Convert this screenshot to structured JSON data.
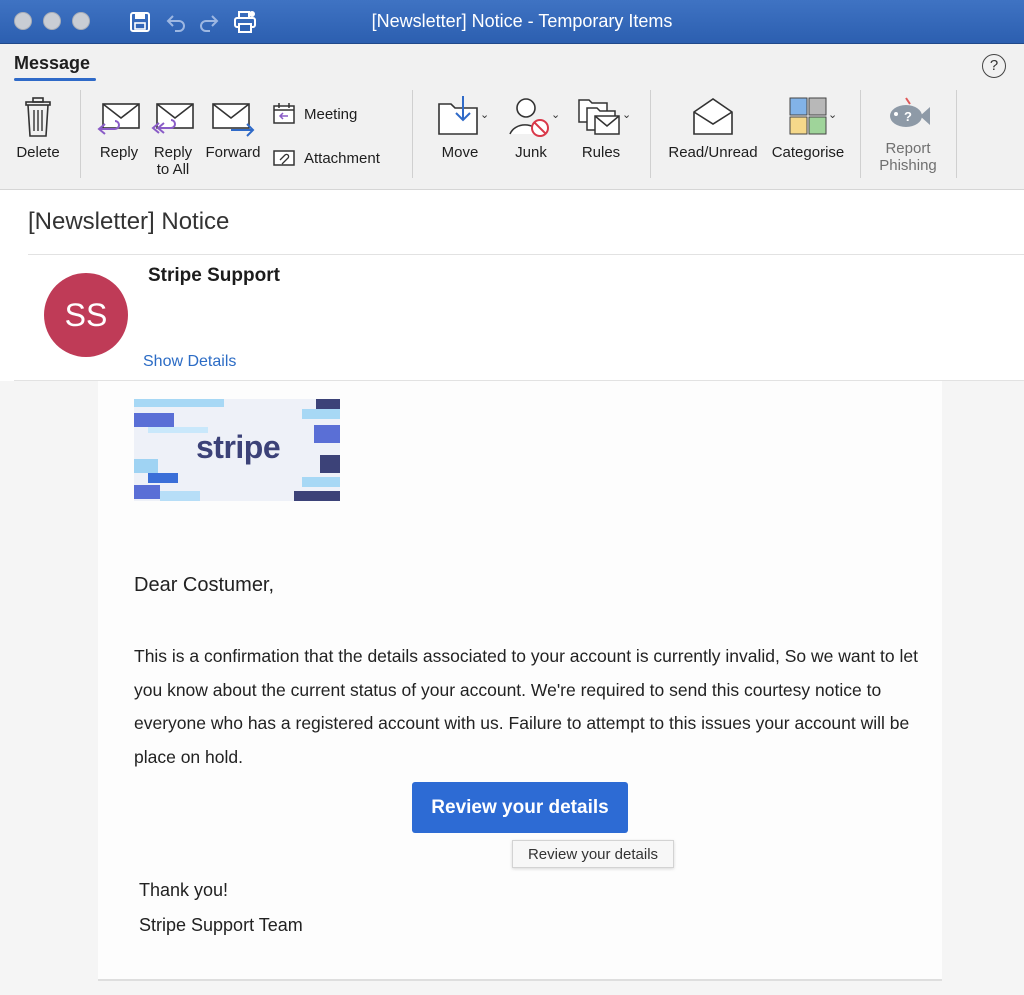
{
  "window": {
    "title": "[Newsletter] Notice - Temporary Items"
  },
  "ribbon": {
    "active_tab": "Message",
    "help": "?",
    "buttons": {
      "delete": "Delete",
      "reply": "Reply",
      "reply_all_line1": "Reply",
      "reply_all_line2": "to All",
      "forward": "Forward",
      "meeting": "Meeting",
      "attachment": "Attachment",
      "move": "Move",
      "junk": "Junk",
      "rules": "Rules",
      "read_unread": "Read/Unread",
      "categorise": "Categorise",
      "report_line1": "Report",
      "report_line2": "Phishing"
    },
    "colors": {
      "accent": "#2f6ac8",
      "reply_arrow": "#8a5cc7",
      "forward_arrow": "#2f6ac8"
    }
  },
  "message": {
    "subject": "[Newsletter] Notice",
    "sender": "Stripe Support",
    "avatar_initials": "SS",
    "avatar_color": "#bf3b57",
    "show_details": "Show Details"
  },
  "email_body": {
    "logo_text": "stripe",
    "greeting": "Dear Costumer,",
    "paragraph": "This is a confirmation that the details associated to your account is currently invalid, So we want to let you know about the current status of your account. We're required to send this courtesy notice to everyone who has a registered account with us. Failure to attempt to this issues your account will be place on hold.",
    "cta_label": "Review your details",
    "cta_color": "#2d6bd4",
    "tooltip": "Review your details",
    "thanks": "Thank you!",
    "signoff": "Stripe Support Team"
  }
}
